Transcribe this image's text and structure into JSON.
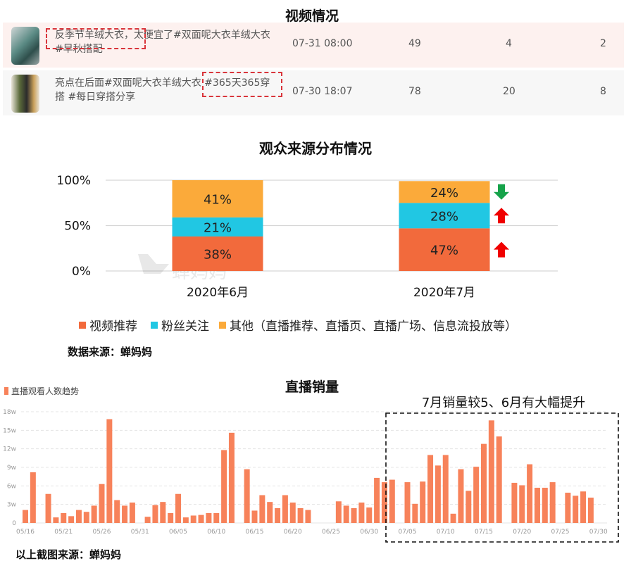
{
  "video_section": {
    "title": "视频情况",
    "rows": [
      {
        "desc": "反季节羊绒大衣，太便宜了#双面呢大衣羊绒大衣 #早秋搭配",
        "time": "07-31 08:00",
        "col1": "49",
        "col2": "4",
        "col3": "2"
      },
      {
        "desc": "亮点在后面#双面呢大衣羊绒大衣 #365天365穿搭 #每日穿搭分享",
        "time": "07-30 18:07",
        "col1": "78",
        "col2": "20",
        "col3": "8"
      }
    ]
  },
  "chart_data": [
    {
      "type": "bar",
      "stacked": true,
      "title": "观众来源分布情况",
      "categories": [
        "2020年6月",
        "2020年7月"
      ],
      "series": [
        {
          "name": "视频推荐",
          "values": [
            38,
            47
          ],
          "labels": [
            "38%",
            "47%"
          ],
          "color": "#f26a3c"
        },
        {
          "name": "粉丝关注",
          "values": [
            21,
            28
          ],
          "labels": [
            "21%",
            "28%"
          ],
          "color": "#21c7e3"
        },
        {
          "name": "其他（直播推荐、直播页、直播广场、信息流投放等）",
          "values": [
            41,
            24
          ],
          "labels": [
            "41%",
            "24%"
          ],
          "color": "#fbaa3a"
        }
      ],
      "ytick_labels": [
        "0%",
        "50%",
        "100%"
      ],
      "ylim": [
        0,
        100
      ],
      "legend_position": "bottom",
      "trend_arrows": [
        "up",
        "up",
        "down"
      ],
      "arrow_colors": {
        "up": "#f00000",
        "down": "#16a34a"
      },
      "watermark": "蝉妈妈"
    },
    {
      "type": "bar",
      "title": "直播销量",
      "legend": "直播观看人数趋势",
      "bar_color": "#f7825a",
      "ylim": [
        0,
        18
      ],
      "ytick_labels": [
        "0",
        "3w",
        "6w",
        "9w",
        "12w",
        "15w",
        "18w"
      ],
      "xtick_labels": [
        "05/16",
        "05/21",
        "05/26",
        "05/31",
        "06/05",
        "06/10",
        "06/15",
        "06/20",
        "06/25",
        "06/30",
        "07/05",
        "07/10",
        "07/15",
        "07/20",
        "07/25",
        "07/30"
      ],
      "values": [
        2.1,
        8.2,
        null,
        4.7,
        0.9,
        1.6,
        1.1,
        2.1,
        1.8,
        2.8,
        6.3,
        16.8,
        3.7,
        2.8,
        3.3,
        null,
        1.0,
        2.9,
        3.4,
        1.6,
        4.7,
        0.9,
        1.2,
        1.3,
        1.6,
        1.6,
        11.8,
        14.6,
        null,
        8.7,
        2.0,
        4.5,
        3.4,
        2.4,
        4.5,
        3.3,
        2.4,
        2.1,
        null,
        null,
        null,
        3.5,
        2.8,
        2.4,
        3.3,
        2.5,
        7.3,
        6.6,
        7.0,
        null,
        6.6,
        3.1,
        6.7,
        11.0,
        9.3,
        11.0,
        1.5,
        8.7,
        5.2,
        9.1,
        12.8,
        16.6,
        14.0,
        null,
        6.5,
        6.1,
        9.5,
        5.7,
        5.7,
        6.6,
        null,
        4.9,
        4.4,
        5.1,
        4.1
      ],
      "annotation": "7月销量较5、6月有大幅提升"
    }
  ],
  "notes": {
    "data_source": "数据来源：蝉妈妈",
    "screenshot_source": "以上截图来源：蝉妈妈"
  }
}
